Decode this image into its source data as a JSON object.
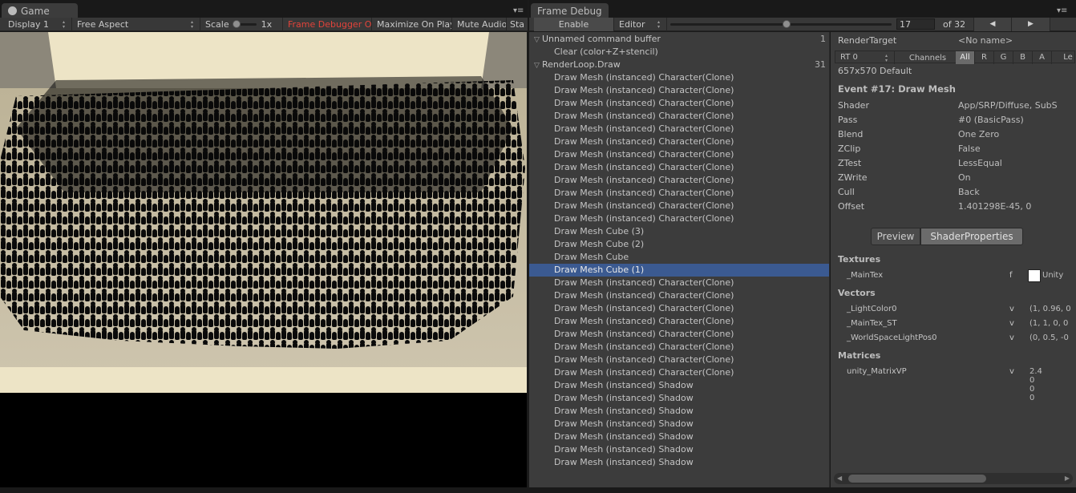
{
  "game": {
    "tab_label": "Game",
    "display": "Display 1",
    "aspect": "Free Aspect",
    "scale_label": "Scale",
    "scale_value": "1x",
    "frame_debugger_on": "Frame Debugger On",
    "maximize_on_play": "Maximize On Play",
    "mute_audio": "Mute Audio",
    "stats_clip": "Sta"
  },
  "frame_debug": {
    "tab_label": "Frame Debug",
    "enable": "Enable",
    "editor": "Editor",
    "event_index": "17",
    "event_total": "of 32",
    "slider_fraction": 0.52,
    "prev_icon": "triangle-left-icon",
    "next_icon": "triangle-right-icon"
  },
  "events": [
    {
      "label": "Unnamed command buffer",
      "count": "1",
      "level": 0,
      "group": true
    },
    {
      "label": "Clear (color+Z+stencil)",
      "count": "",
      "level": 1
    },
    {
      "label": "RenderLoop.Draw",
      "count": "31",
      "level": 0,
      "group": true
    },
    {
      "label": "Draw Mesh (instanced) Character(Clone)",
      "count": "",
      "level": 1
    },
    {
      "label": "Draw Mesh (instanced) Character(Clone)",
      "count": "",
      "level": 1
    },
    {
      "label": "Draw Mesh (instanced) Character(Clone)",
      "count": "",
      "level": 1
    },
    {
      "label": "Draw Mesh (instanced) Character(Clone)",
      "count": "",
      "level": 1
    },
    {
      "label": "Draw Mesh (instanced) Character(Clone)",
      "count": "",
      "level": 1
    },
    {
      "label": "Draw Mesh (instanced) Character(Clone)",
      "count": "",
      "level": 1
    },
    {
      "label": "Draw Mesh (instanced) Character(Clone)",
      "count": "",
      "level": 1
    },
    {
      "label": "Draw Mesh (instanced) Character(Clone)",
      "count": "",
      "level": 1
    },
    {
      "label": "Draw Mesh (instanced) Character(Clone)",
      "count": "",
      "level": 1
    },
    {
      "label": "Draw Mesh (instanced) Character(Clone)",
      "count": "",
      "level": 1
    },
    {
      "label": "Draw Mesh (instanced) Character(Clone)",
      "count": "",
      "level": 1
    },
    {
      "label": "Draw Mesh (instanced) Character(Clone)",
      "count": "",
      "level": 1
    },
    {
      "label": "Draw Mesh Cube (3)",
      "count": "",
      "level": 1
    },
    {
      "label": "Draw Mesh Cube (2)",
      "count": "",
      "level": 1
    },
    {
      "label": "Draw Mesh Cube",
      "count": "",
      "level": 1
    },
    {
      "label": "Draw Mesh Cube (1)",
      "count": "",
      "level": 1,
      "selected": true
    },
    {
      "label": "Draw Mesh (instanced) Character(Clone)",
      "count": "",
      "level": 1
    },
    {
      "label": "Draw Mesh (instanced) Character(Clone)",
      "count": "",
      "level": 1
    },
    {
      "label": "Draw Mesh (instanced) Character(Clone)",
      "count": "",
      "level": 1
    },
    {
      "label": "Draw Mesh (instanced) Character(Clone)",
      "count": "",
      "level": 1
    },
    {
      "label": "Draw Mesh (instanced) Character(Clone)",
      "count": "",
      "level": 1
    },
    {
      "label": "Draw Mesh (instanced) Character(Clone)",
      "count": "",
      "level": 1
    },
    {
      "label": "Draw Mesh (instanced) Character(Clone)",
      "count": "",
      "level": 1
    },
    {
      "label": "Draw Mesh (instanced) Character(Clone)",
      "count": "",
      "level": 1
    },
    {
      "label": "Draw Mesh (instanced) Shadow",
      "count": "",
      "level": 1
    },
    {
      "label": "Draw Mesh (instanced) Shadow",
      "count": "",
      "level": 1
    },
    {
      "label": "Draw Mesh (instanced) Shadow",
      "count": "",
      "level": 1
    },
    {
      "label": "Draw Mesh (instanced) Shadow",
      "count": "",
      "level": 1
    },
    {
      "label": "Draw Mesh (instanced) Shadow",
      "count": "",
      "level": 1
    },
    {
      "label": "Draw Mesh (instanced) Shadow",
      "count": "",
      "level": 1
    },
    {
      "label": "Draw Mesh (instanced) Shadow",
      "count": "",
      "level": 1
    }
  ],
  "details": {
    "render_target_label": "RenderTarget",
    "render_target_value": "<No name>",
    "rt_dropdown": "RT 0",
    "channels_label": "Channels",
    "channels": [
      "All",
      "R",
      "G",
      "B",
      "A"
    ],
    "levels_clip": "Le",
    "resolution": "657x570 Default",
    "event_title": "Event #17: Draw Mesh",
    "props": [
      {
        "k": "Shader",
        "v": "App/SRP/Diffuse, SubS"
      },
      {
        "k": "Pass",
        "v": "#0 (BasicPass)"
      },
      {
        "k": "Blend",
        "v": "One Zero"
      },
      {
        "k": "ZClip",
        "v": "False"
      },
      {
        "k": "ZTest",
        "v": "LessEqual"
      },
      {
        "k": "ZWrite",
        "v": "On"
      },
      {
        "k": "Cull",
        "v": "Back"
      },
      {
        "k": "Offset",
        "v": "1.401298E-45, 0"
      }
    ],
    "preview_tab": "Preview",
    "shader_props_tab": "ShaderProperties",
    "textures_header": "Textures",
    "textures": [
      {
        "name": "_MainTex",
        "stage": "f",
        "value": "Unity"
      }
    ],
    "vectors_header": "Vectors",
    "vectors": [
      {
        "name": "_LightColor0",
        "stage": "v",
        "value": "(1, 0.96, 0"
      },
      {
        "name": "_MainTex_ST",
        "stage": "v",
        "value": "(1, 1, 0, 0"
      },
      {
        "name": "_WorldSpaceLightPos0",
        "stage": "v",
        "value": "(0, 0.5, -0"
      }
    ],
    "matrices_header": "Matrices",
    "matrices": [
      {
        "name": "unity_MatrixVP",
        "stage": "v",
        "values": [
          "2.4",
          "0",
          "0",
          "0"
        ]
      }
    ]
  },
  "colors": {
    "selection": "#3b5a91",
    "debugger_on": "#e2433a",
    "floor": "#c9c0a8",
    "wall": "#ede4c6"
  }
}
